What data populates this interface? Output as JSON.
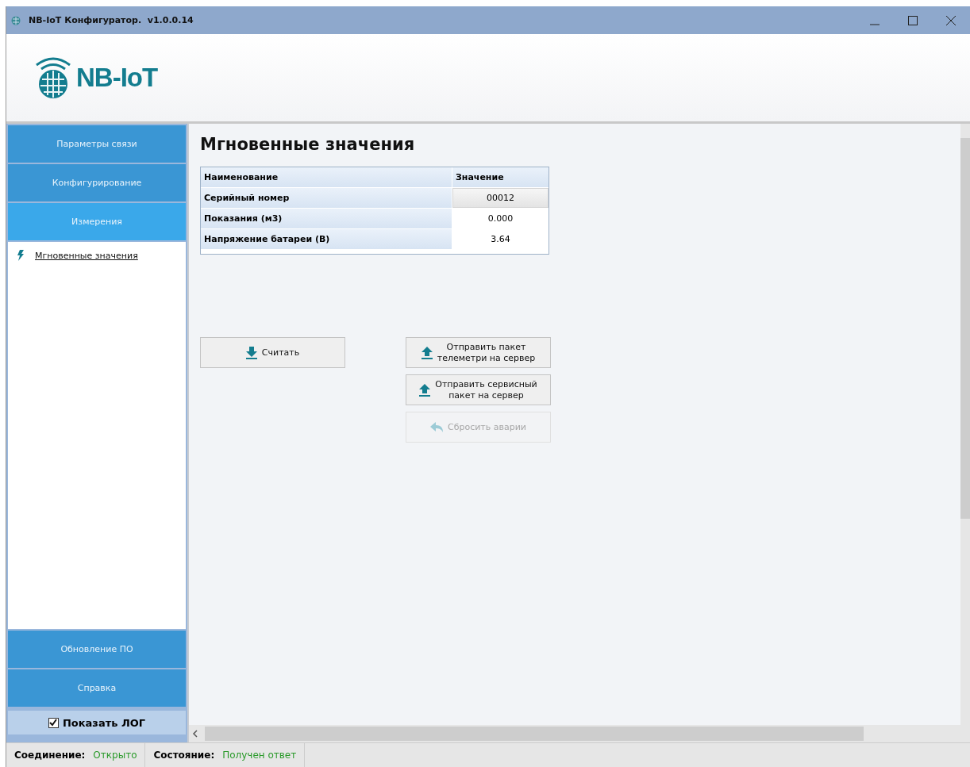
{
  "window": {
    "title": "NB-IoT Конфигуратор.  v1.0.0.14"
  },
  "header": {
    "logo_text": "NB-IoT"
  },
  "sidebar": {
    "nav": [
      {
        "label": "Параметры связи",
        "selected": false
      },
      {
        "label": "Конфигурирование",
        "selected": false
      },
      {
        "label": "Измерения",
        "selected": true
      }
    ],
    "subitems": [
      {
        "label": "Мгновенные значения"
      }
    ],
    "nav_bottom": [
      {
        "label": "Обновление ПО",
        "selected": false
      },
      {
        "label": "Справка",
        "selected": false
      }
    ],
    "show_log": {
      "label": "Показать ЛОГ",
      "checked": true
    }
  },
  "content": {
    "title": "Мгновенные значения",
    "table": {
      "columns": [
        "Наименование",
        "Значение"
      ],
      "rows": [
        {
          "name": "Серийный номер",
          "value": "00012",
          "selected": true
        },
        {
          "name": "Показания (м3)",
          "value": "0.000",
          "selected": false
        },
        {
          "name": "Напряжение батареи (В)",
          "value": "3.64",
          "selected": false
        }
      ]
    },
    "buttons": [
      {
        "label": "Считать",
        "kind": "download",
        "disabled": false
      },
      {
        "label": "Отправить пакет\nтелеметри на сервер",
        "kind": "upload",
        "disabled": false
      },
      {
        "label": "Отправить сервисный\nпакет на сервер",
        "kind": "upload",
        "disabled": false
      },
      {
        "label": "Сбросить аварии",
        "kind": "undo",
        "disabled": true
      }
    ]
  },
  "status_bar": [
    {
      "label": "Соединение:",
      "value": "Открыто"
    },
    {
      "label": "Состояние:",
      "value": "Получен ответ"
    }
  ]
}
